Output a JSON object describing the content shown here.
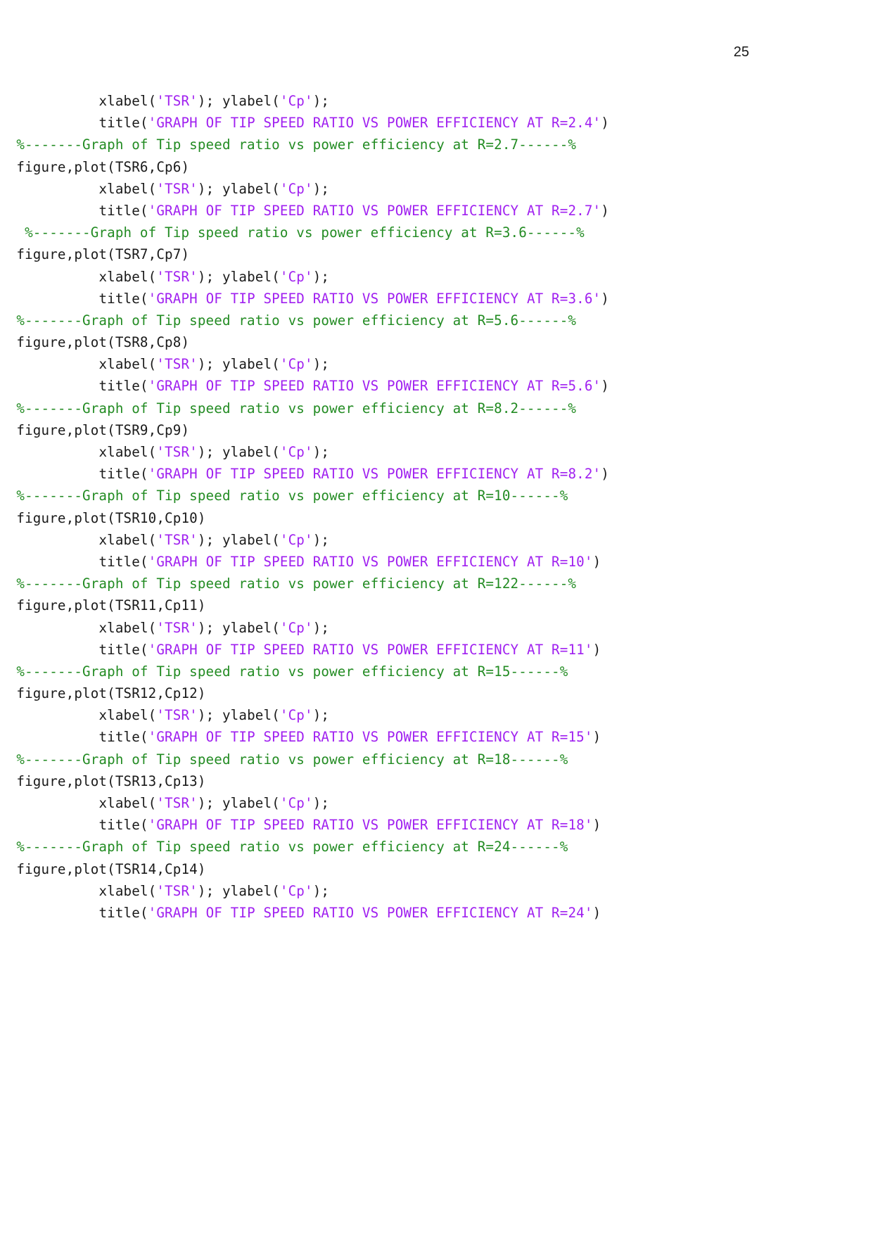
{
  "page": {
    "number": "25",
    "colors": {
      "text": "#1a1a1a",
      "string": "#a020f0",
      "comment": "#228B22",
      "background": "#ffffff"
    }
  },
  "code": {
    "language": "MATLAB",
    "lines": [
      {
        "indent": "            ",
        "segments": [
          {
            "type": "plain",
            "text": "xlabel("
          },
          {
            "type": "string",
            "text": "'TSR'"
          },
          {
            "type": "plain",
            "text": "); ylabel("
          },
          {
            "type": "string",
            "text": "'Cp'"
          },
          {
            "type": "plain",
            "text": ");"
          }
        ]
      },
      {
        "indent": "            ",
        "segments": [
          {
            "type": "plain",
            "text": "title("
          },
          {
            "type": "string",
            "text": "'GRAPH OF TIP SPEED RATIO VS POWER EFFICIENCY AT R=2.4'"
          },
          {
            "type": "plain",
            "text": ")"
          }
        ]
      },
      {
        "indent": "  ",
        "segments": [
          {
            "type": "comment",
            "text": "%-------Graph of Tip speed ratio vs power efficiency at R=2.7------%"
          }
        ]
      },
      {
        "indent": "  ",
        "segments": [
          {
            "type": "plain",
            "text": "figure,plot(TSR6,Cp6)"
          }
        ]
      },
      {
        "indent": "            ",
        "segments": [
          {
            "type": "plain",
            "text": "xlabel("
          },
          {
            "type": "string",
            "text": "'TSR'"
          },
          {
            "type": "plain",
            "text": "); ylabel("
          },
          {
            "type": "string",
            "text": "'Cp'"
          },
          {
            "type": "plain",
            "text": ");"
          }
        ]
      },
      {
        "indent": "            ",
        "segments": [
          {
            "type": "plain",
            "text": "title("
          },
          {
            "type": "string",
            "text": "'GRAPH OF TIP SPEED RATIO VS POWER EFFICIENCY AT R=2.7'"
          },
          {
            "type": "plain",
            "text": ")"
          }
        ]
      },
      {
        "indent": "   ",
        "segments": [
          {
            "type": "comment",
            "text": "%-------Graph of Tip speed ratio vs power efficiency at R=3.6------%"
          }
        ]
      },
      {
        "indent": "  ",
        "segments": [
          {
            "type": "plain",
            "text": "figure,plot(TSR7,Cp7)"
          }
        ]
      },
      {
        "indent": "            ",
        "segments": [
          {
            "type": "plain",
            "text": "xlabel("
          },
          {
            "type": "string",
            "text": "'TSR'"
          },
          {
            "type": "plain",
            "text": "); ylabel("
          },
          {
            "type": "string",
            "text": "'Cp'"
          },
          {
            "type": "plain",
            "text": ");"
          }
        ]
      },
      {
        "indent": "            ",
        "segments": [
          {
            "type": "plain",
            "text": "title("
          },
          {
            "type": "string",
            "text": "'GRAPH OF TIP SPEED RATIO VS POWER EFFICIENCY AT R=3.6'"
          },
          {
            "type": "plain",
            "text": ")"
          }
        ]
      },
      {
        "indent": "  ",
        "segments": [
          {
            "type": "comment",
            "text": "%-------Graph of Tip speed ratio vs power efficiency at R=5.6------%"
          }
        ]
      },
      {
        "indent": "  ",
        "segments": [
          {
            "type": "plain",
            "text": "figure,plot(TSR8,Cp8)"
          }
        ]
      },
      {
        "indent": "            ",
        "segments": [
          {
            "type": "plain",
            "text": "xlabel("
          },
          {
            "type": "string",
            "text": "'TSR'"
          },
          {
            "type": "plain",
            "text": "); ylabel("
          },
          {
            "type": "string",
            "text": "'Cp'"
          },
          {
            "type": "plain",
            "text": ");"
          }
        ]
      },
      {
        "indent": "            ",
        "segments": [
          {
            "type": "plain",
            "text": "title("
          },
          {
            "type": "string",
            "text": "'GRAPH OF TIP SPEED RATIO VS POWER EFFICIENCY AT R=5.6'"
          },
          {
            "type": "plain",
            "text": ")"
          }
        ]
      },
      {
        "indent": "  ",
        "segments": [
          {
            "type": "comment",
            "text": "%-------Graph of Tip speed ratio vs power efficiency at R=8.2------%"
          }
        ]
      },
      {
        "indent": "  ",
        "segments": [
          {
            "type": "plain",
            "text": "figure,plot(TSR9,Cp9)"
          }
        ]
      },
      {
        "indent": "            ",
        "segments": [
          {
            "type": "plain",
            "text": "xlabel("
          },
          {
            "type": "string",
            "text": "'TSR'"
          },
          {
            "type": "plain",
            "text": "); ylabel("
          },
          {
            "type": "string",
            "text": "'Cp'"
          },
          {
            "type": "plain",
            "text": ");"
          }
        ]
      },
      {
        "indent": "            ",
        "segments": [
          {
            "type": "plain",
            "text": "title("
          },
          {
            "type": "string",
            "text": "'GRAPH OF TIP SPEED RATIO VS POWER EFFICIENCY AT R=8.2'"
          },
          {
            "type": "plain",
            "text": ")"
          }
        ]
      },
      {
        "indent": "  ",
        "segments": [
          {
            "type": "comment",
            "text": "%-------Graph of Tip speed ratio vs power efficiency at R=10------%"
          }
        ]
      },
      {
        "indent": "  ",
        "segments": [
          {
            "type": "plain",
            "text": "figure,plot(TSR10,Cp10)"
          }
        ]
      },
      {
        "indent": "            ",
        "segments": [
          {
            "type": "plain",
            "text": "xlabel("
          },
          {
            "type": "string",
            "text": "'TSR'"
          },
          {
            "type": "plain",
            "text": "); ylabel("
          },
          {
            "type": "string",
            "text": "'Cp'"
          },
          {
            "type": "plain",
            "text": ");"
          }
        ]
      },
      {
        "indent": "            ",
        "segments": [
          {
            "type": "plain",
            "text": "title("
          },
          {
            "type": "string",
            "text": "'GRAPH OF TIP SPEED RATIO VS POWER EFFICIENCY AT R=10'"
          },
          {
            "type": "plain",
            "text": ")"
          }
        ]
      },
      {
        "indent": "  ",
        "segments": [
          {
            "type": "comment",
            "text": "%-------Graph of Tip speed ratio vs power efficiency at R=122------%"
          }
        ]
      },
      {
        "indent": "  ",
        "segments": [
          {
            "type": "plain",
            "text": "figure,plot(TSR11,Cp11)"
          }
        ]
      },
      {
        "indent": "            ",
        "segments": [
          {
            "type": "plain",
            "text": "xlabel("
          },
          {
            "type": "string",
            "text": "'TSR'"
          },
          {
            "type": "plain",
            "text": "); ylabel("
          },
          {
            "type": "string",
            "text": "'Cp'"
          },
          {
            "type": "plain",
            "text": ");"
          }
        ]
      },
      {
        "indent": "            ",
        "segments": [
          {
            "type": "plain",
            "text": "title("
          },
          {
            "type": "string",
            "text": "'GRAPH OF TIP SPEED RATIO VS POWER EFFICIENCY AT R=11'"
          },
          {
            "type": "plain",
            "text": ")"
          }
        ]
      },
      {
        "indent": "  ",
        "segments": [
          {
            "type": "comment",
            "text": "%-------Graph of Tip speed ratio vs power efficiency at R=15------%"
          }
        ]
      },
      {
        "indent": "  ",
        "segments": [
          {
            "type": "plain",
            "text": "figure,plot(TSR12,Cp12)"
          }
        ]
      },
      {
        "indent": "            ",
        "segments": [
          {
            "type": "plain",
            "text": "xlabel("
          },
          {
            "type": "string",
            "text": "'TSR'"
          },
          {
            "type": "plain",
            "text": "); ylabel("
          },
          {
            "type": "string",
            "text": "'Cp'"
          },
          {
            "type": "plain",
            "text": ");"
          }
        ]
      },
      {
        "indent": "            ",
        "segments": [
          {
            "type": "plain",
            "text": "title("
          },
          {
            "type": "string",
            "text": "'GRAPH OF TIP SPEED RATIO VS POWER EFFICIENCY AT R=15'"
          },
          {
            "type": "plain",
            "text": ")"
          }
        ]
      },
      {
        "indent": "  ",
        "segments": [
          {
            "type": "comment",
            "text": "%-------Graph of Tip speed ratio vs power efficiency at R=18------%"
          }
        ]
      },
      {
        "indent": "  ",
        "segments": [
          {
            "type": "plain",
            "text": "figure,plot(TSR13,Cp13)"
          }
        ]
      },
      {
        "indent": "            ",
        "segments": [
          {
            "type": "plain",
            "text": "xlabel("
          },
          {
            "type": "string",
            "text": "'TSR'"
          },
          {
            "type": "plain",
            "text": "); ylabel("
          },
          {
            "type": "string",
            "text": "'Cp'"
          },
          {
            "type": "plain",
            "text": ");"
          }
        ]
      },
      {
        "indent": "            ",
        "segments": [
          {
            "type": "plain",
            "text": "title("
          },
          {
            "type": "string",
            "text": "'GRAPH OF TIP SPEED RATIO VS POWER EFFICIENCY AT R=18'"
          },
          {
            "type": "plain",
            "text": ")"
          }
        ]
      },
      {
        "indent": "  ",
        "segments": [
          {
            "type": "comment",
            "text": "%-------Graph of Tip speed ratio vs power efficiency at R=24------%"
          }
        ]
      },
      {
        "indent": "  ",
        "segments": [
          {
            "type": "plain",
            "text": "figure,plot(TSR14,Cp14)"
          }
        ]
      },
      {
        "indent": "            ",
        "segments": [
          {
            "type": "plain",
            "text": "xlabel("
          },
          {
            "type": "string",
            "text": "'TSR'"
          },
          {
            "type": "plain",
            "text": "); ylabel("
          },
          {
            "type": "string",
            "text": "'Cp'"
          },
          {
            "type": "plain",
            "text": ");"
          }
        ]
      },
      {
        "indent": "            ",
        "segments": [
          {
            "type": "plain",
            "text": "title("
          },
          {
            "type": "string",
            "text": "'GRAPH OF TIP SPEED RATIO VS POWER EFFICIENCY AT R=24'"
          },
          {
            "type": "plain",
            "text": ")"
          }
        ]
      }
    ]
  }
}
